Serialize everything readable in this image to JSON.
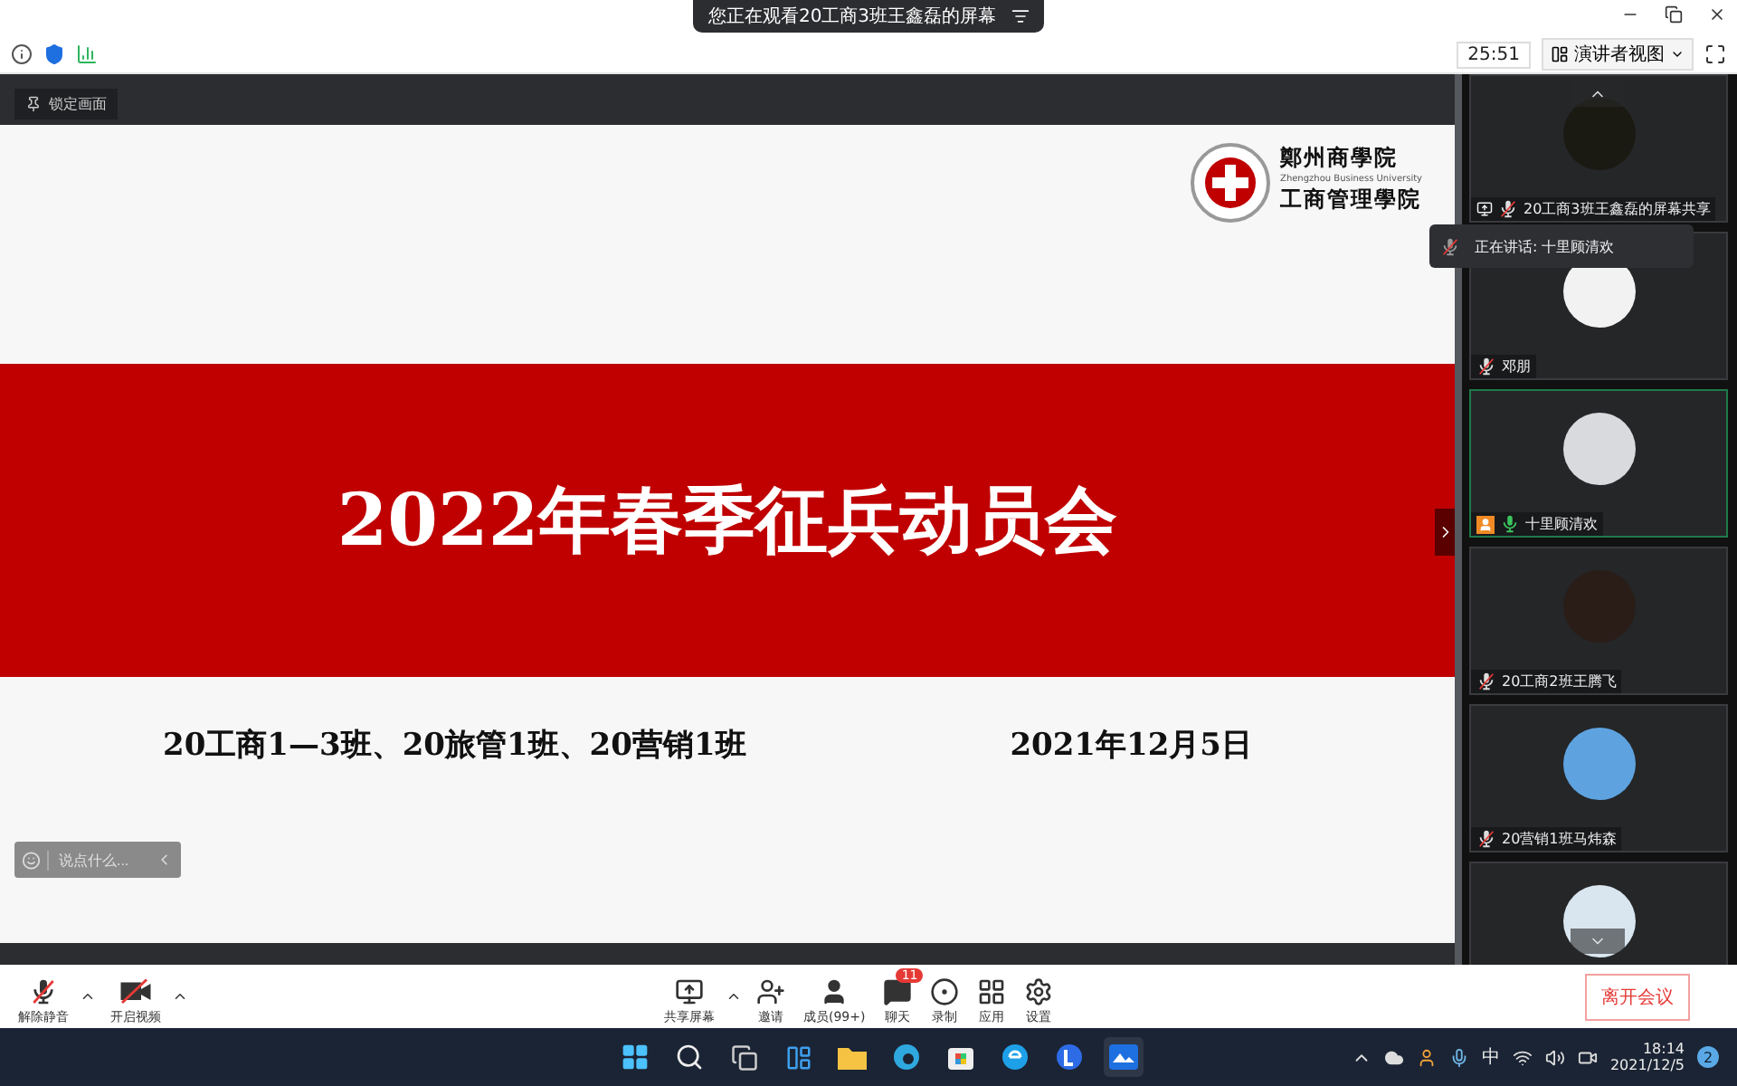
{
  "window": {
    "banner": "您正在观看20工商3班王鑫磊的屏幕"
  },
  "toolbar": {
    "timer": "25:51",
    "view_button": "演讲者视图"
  },
  "pin_button": "锁定画面",
  "slide": {
    "logo_name": "鄭州商學院",
    "logo_subtitle": "Zhengzhou Business University",
    "logo_school": "工商管理學院",
    "title": "2022年春季征兵动员会",
    "classes": "20工商1—3班、20旅管1班、20营销1班",
    "date": "2021年12月5日"
  },
  "chat_input": {
    "placeholder": "说点什么..."
  },
  "speaking": {
    "label": "正在讲话: 十里顾清欢"
  },
  "participants": [
    {
      "kind": "sharing",
      "name": "20工商3班王鑫磊的屏幕共享",
      "muted": true,
      "active": false,
      "host": false
    },
    {
      "kind": "member",
      "name": "邓朋",
      "muted": true,
      "active": false,
      "host": false
    },
    {
      "kind": "member",
      "name": "十里顾清欢",
      "muted": false,
      "active": true,
      "host": true
    },
    {
      "kind": "member",
      "name": "20工商2班王腾飞",
      "muted": true,
      "active": false,
      "host": false
    },
    {
      "kind": "member",
      "name": "20营销1班马炜森",
      "muted": true,
      "active": false,
      "host": false
    },
    {
      "kind": "member",
      "active": false
    }
  ],
  "controls_left": [
    {
      "kind": "mic",
      "label": "解除静音",
      "off": true
    },
    {
      "kind": "video",
      "label": "开启视频",
      "off": true
    }
  ],
  "controls_center": [
    {
      "kind": "share",
      "label": "共享屏幕"
    },
    {
      "kind": "invite",
      "label": "邀请"
    },
    {
      "kind": "members",
      "label": "成员(99+)"
    },
    {
      "kind": "chat",
      "label": "聊天",
      "badge": "11"
    },
    {
      "kind": "record",
      "label": "录制"
    },
    {
      "kind": "apps",
      "label": "应用"
    },
    {
      "kind": "settings",
      "label": "设置"
    }
  ],
  "leave_button": "离开会议",
  "taskbar": {
    "ime": "中",
    "time": "18:14",
    "date": "2021/12/5",
    "notifications": "2"
  }
}
